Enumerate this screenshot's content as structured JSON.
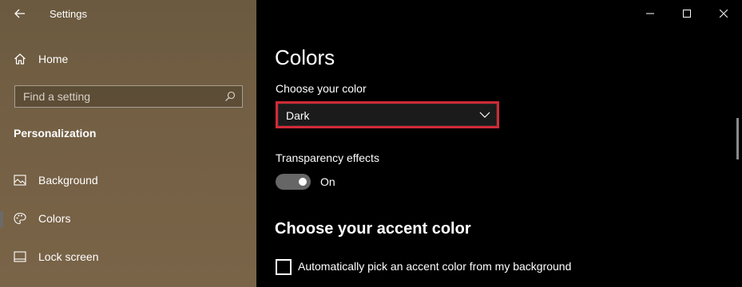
{
  "window": {
    "title": "Settings"
  },
  "sidebar": {
    "home_label": "Home",
    "search_placeholder": "Find a setting",
    "section": "Personalization",
    "items": [
      {
        "label": "Background",
        "icon": "image-icon"
      },
      {
        "label": "Colors",
        "icon": "palette-icon",
        "active": true
      },
      {
        "label": "Lock screen",
        "icon": "lock-screen-icon"
      }
    ]
  },
  "main": {
    "title": "Colors",
    "choose_color_label": "Choose your color",
    "choose_color_value": "Dark",
    "transparency_label": "Transparency effects",
    "transparency_state": "On",
    "accent_heading": "Choose your accent color",
    "auto_accent_label": "Automatically pick an accent color from my background",
    "auto_accent_checked": false
  },
  "colors": {
    "highlight_border": "#d12a37",
    "main_bg": "#000000",
    "sidebar_bg": "#735f44"
  }
}
